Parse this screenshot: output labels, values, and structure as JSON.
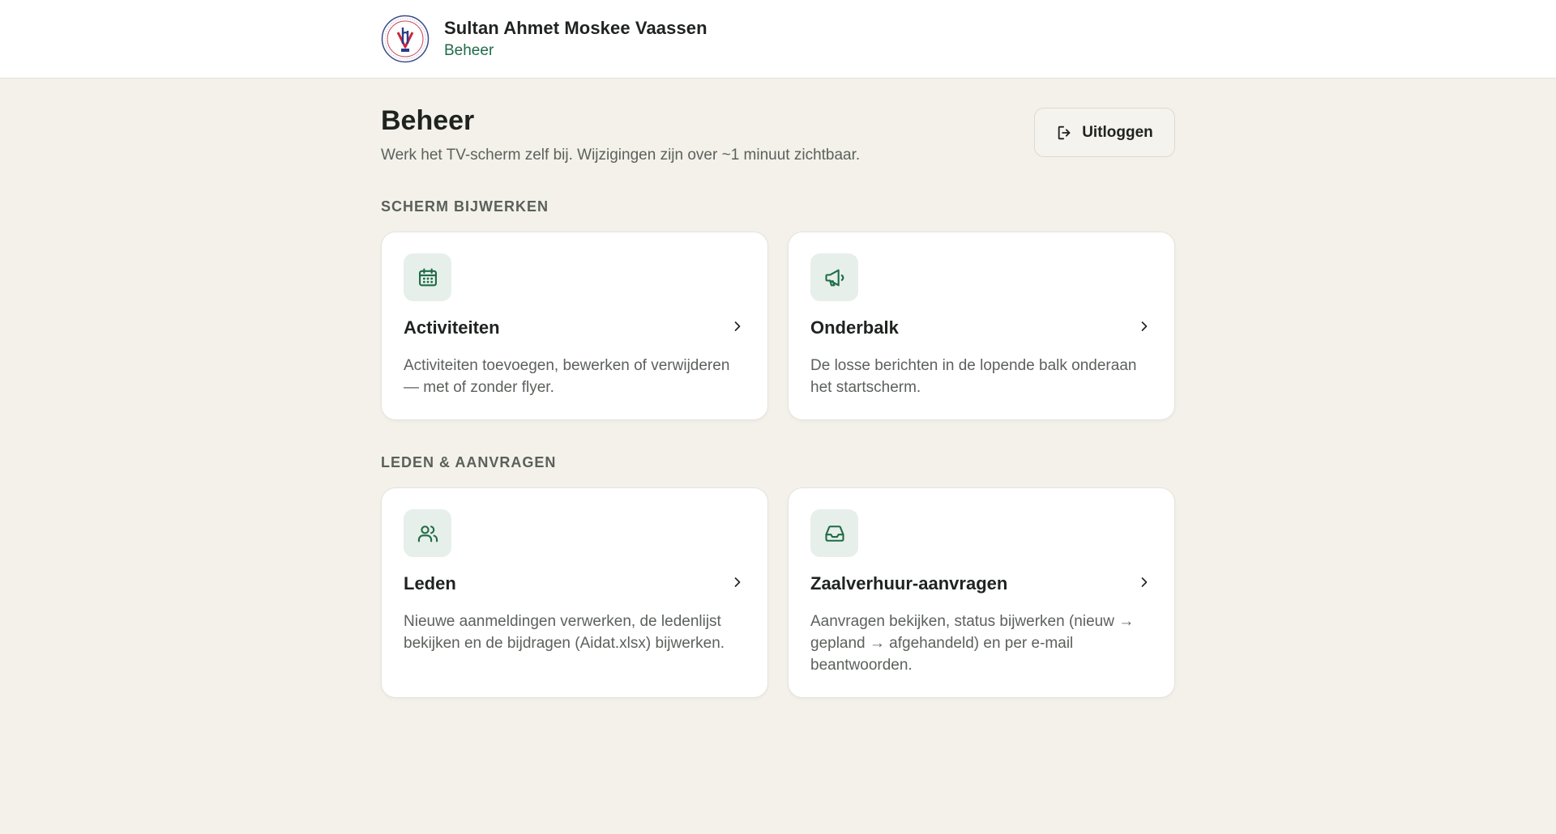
{
  "header": {
    "title": "Sultan Ahmet Moskee Vaassen",
    "subtitle": "Beheer",
    "logo_icon": "mosque-logo-icon"
  },
  "page": {
    "title": "Beheer",
    "subtitle": "Werk het TV-scherm zelf bij. Wijzigingen zijn over ~1 minuut zichtbaar.",
    "logout_label": "Uitloggen"
  },
  "sections": [
    {
      "label": "SCHERM BIJWERKEN",
      "cards": [
        {
          "icon": "calendar-icon",
          "title": "Activiteiten",
          "description": "Activiteiten toevoegen, bewerken of verwijderen — met of zonder flyer."
        },
        {
          "icon": "megaphone-icon",
          "title": "Onderbalk",
          "description": "De losse berichten in de lopende balk onderaan het startscherm."
        }
      ]
    },
    {
      "label": "LEDEN & AANVRAGEN",
      "cards": [
        {
          "icon": "users-icon",
          "title": "Leden",
          "description": "Nieuwe aanmeldingen verwerken, de ledenlijst bekijken en de bijdragen (Aidat.xlsx) bijwerken."
        },
        {
          "icon": "inbox-icon",
          "title": "Zaalverhuur-aanvragen",
          "description": "Aanvragen bekijken, status bijwerken (nieuw → gepland → afgehandeld) en per e-mail beantwoorden."
        }
      ]
    }
  ],
  "colors": {
    "accent": "#1f6b47",
    "background": "#f3f1ea",
    "icon_tile": "#e6efe9"
  }
}
